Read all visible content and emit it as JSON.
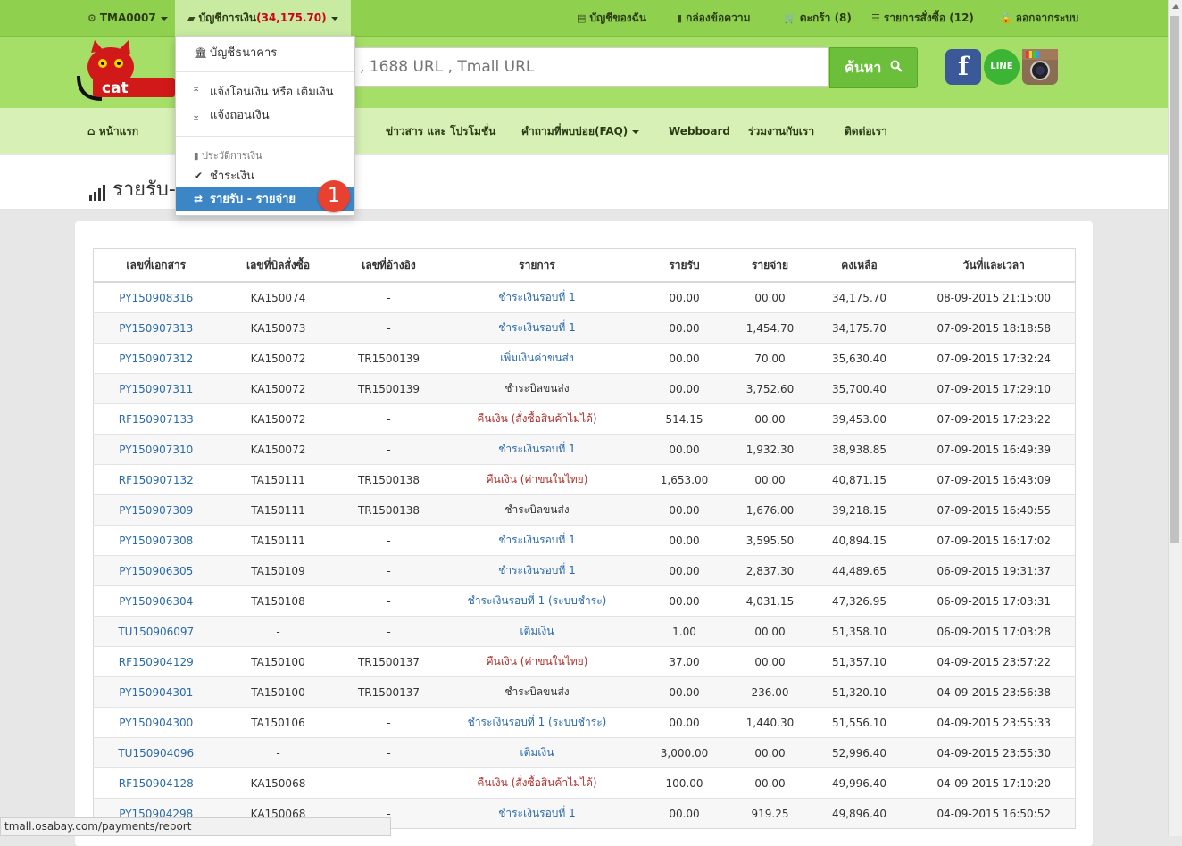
{
  "topbar": {
    "user": "TMA0007",
    "account_label": "บัญชีการเงิน",
    "account_balance": "(34,175.70)",
    "my_account": "บัญชีของฉัน",
    "inbox": "กล่องข้อความ",
    "cart": "ตะกร้า (8)",
    "orders": "รายการสั่งซื้อ (12)",
    "logout": "ออกจากระบบ"
  },
  "search": {
    "placeholder": ", 1688 URL , Tmall URL",
    "button_label": "ค้นหา"
  },
  "social": {
    "line_label": "LINE"
  },
  "nav": {
    "home": "หน้าแรก",
    "news": "ข่าวสาร และ โปรโมชั่น",
    "faq": "คำถามที่พบบ่อย(FAQ)",
    "webboard": "Webboard",
    "partner": "ร่วมงานกับเรา",
    "contact": "ติดต่อเรา"
  },
  "page_title": "รายรับ-",
  "dropdown": {
    "bank_account": "บัญชีธนาคาร",
    "notify_transfer": "แจ้งโอนเงิน หรือ เติมเงิน",
    "notify_withdraw": "แจ้งถอนเงิน",
    "history_header": "ประวัติการเงิน",
    "payment": "ชำระเงิน",
    "income_expense": "รายรับ - รายจ่าย",
    "badge": "1"
  },
  "table": {
    "headers": [
      "เลขที่เอกสาร",
      "เลขที่บิลสั่งซื้อ",
      "เลขที่อ้างอิง",
      "รายการ",
      "รายรับ",
      "รายจ่าย",
      "คงเหลือ",
      "วันที่และเวลา"
    ],
    "rows": [
      [
        "PY150908316",
        "KA150074",
        "-",
        "ชำระเงินรอบที่ 1",
        "00.00",
        "00.00",
        "34,175.70",
        "08-09-2015 21:15:00"
      ],
      [
        "PY150907313",
        "KA150073",
        "-",
        "ชำระเงินรอบที่ 1",
        "00.00",
        "1,454.70",
        "34,175.70",
        "07-09-2015 18:18:58"
      ],
      [
        "PY150907312",
        "KA150072",
        "TR1500139",
        "เพิ่มเงินค่าขนส่ง",
        "00.00",
        "70.00",
        "35,630.40",
        "07-09-2015 17:32:24"
      ],
      [
        "PY150907311",
        "KA150072",
        "TR1500139",
        "ชำระบิลขนส่ง",
        "00.00",
        "3,752.60",
        "35,700.40",
        "07-09-2015 17:29:10"
      ],
      [
        "RF150907133",
        "KA150072",
        "-",
        "คืนเงิน (สั่งซื้อสินค้าไม่ได้)",
        "514.15",
        "00.00",
        "39,453.00",
        "07-09-2015 17:23:22"
      ],
      [
        "PY150907310",
        "KA150072",
        "-",
        "ชำระเงินรอบที่ 1",
        "00.00",
        "1,932.30",
        "38,938.85",
        "07-09-2015 16:49:39"
      ],
      [
        "RF150907132",
        "TA150111",
        "TR1500138",
        "คืนเงิน (ค่าขนในไทย)",
        "1,653.00",
        "00.00",
        "40,871.15",
        "07-09-2015 16:43:09"
      ],
      [
        "PY150907309",
        "TA150111",
        "TR1500138",
        "ชำระบิลขนส่ง",
        "00.00",
        "1,676.00",
        "39,218.15",
        "07-09-2015 16:40:55"
      ],
      [
        "PY150907308",
        "TA150111",
        "-",
        "ชำระเงินรอบที่ 1",
        "00.00",
        "3,595.50",
        "40,894.15",
        "07-09-2015 16:17:02"
      ],
      [
        "PY150906305",
        "TA150109",
        "-",
        "ชำระเงินรอบที่ 1",
        "00.00",
        "2,837.30",
        "44,489.65",
        "06-09-2015 19:31:37"
      ],
      [
        "PY150906304",
        "TA150108",
        "-",
        "ชำระเงินรอบที่ 1 (ระบบชำระ)",
        "00.00",
        "4,031.15",
        "47,326.95",
        "06-09-2015 17:03:31"
      ],
      [
        "TU150906097",
        "-",
        "-",
        "เติมเงิน",
        "1.00",
        "00.00",
        "51,358.10",
        "06-09-2015 17:03:28"
      ],
      [
        "RF150904129",
        "TA150100",
        "TR1500137",
        "คืนเงิน (ค่าขนในไทย)",
        "37.00",
        "00.00",
        "51,357.10",
        "04-09-2015 23:57:22"
      ],
      [
        "PY150904301",
        "TA150100",
        "TR1500137",
        "ชำระบิลขนส่ง",
        "00.00",
        "236.00",
        "51,320.10",
        "04-09-2015 23:56:38"
      ],
      [
        "PY150904300",
        "TA150106",
        "-",
        "ชำระเงินรอบที่ 1 (ระบบชำระ)",
        "00.00",
        "1,440.30",
        "51,556.10",
        "04-09-2015 23:55:33"
      ],
      [
        "TU150904096",
        "-",
        "-",
        "เติมเงิน",
        "3,000.00",
        "00.00",
        "52,996.40",
        "04-09-2015 23:55:30"
      ],
      [
        "RF150904128",
        "KA150068",
        "-",
        "คืนเงิน (สั่งซื้อสินค้าไม่ได้)",
        "100.00",
        "00.00",
        "49,996.40",
        "04-09-2015 17:10:20"
      ],
      [
        "PY150904298",
        "KA150068",
        "-",
        "ชำระเงินรอบที่ 1",
        "00.00",
        "919.25",
        "49,896.40",
        "04-09-2015 16:50:52"
      ]
    ]
  },
  "status_bar": "tmall.osabay.com/payments/report"
}
